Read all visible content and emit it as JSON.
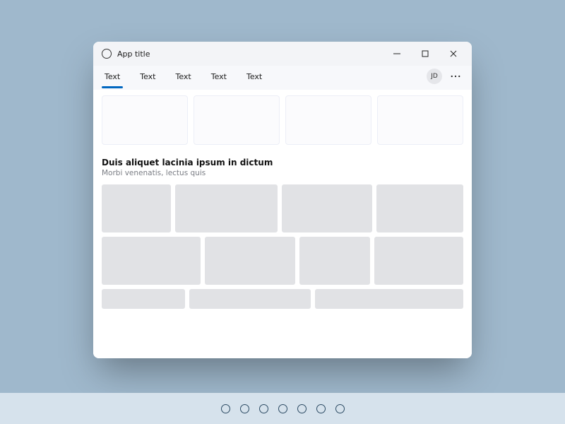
{
  "colors": {
    "accent": "#0067c0",
    "bg": "#9fb8cc",
    "strip": "#d6e2ec"
  },
  "window": {
    "title": "App title",
    "tabs": [
      "Text",
      "Text",
      "Text",
      "Text",
      "Text"
    ],
    "active_tab_index": 0,
    "avatar_initials": "JD"
  },
  "section": {
    "title": "Duis aliquet lacinia ipsum in dictum",
    "subtitle": "Morbi venenatis, lectus quis"
  },
  "pager": {
    "count": 7
  }
}
